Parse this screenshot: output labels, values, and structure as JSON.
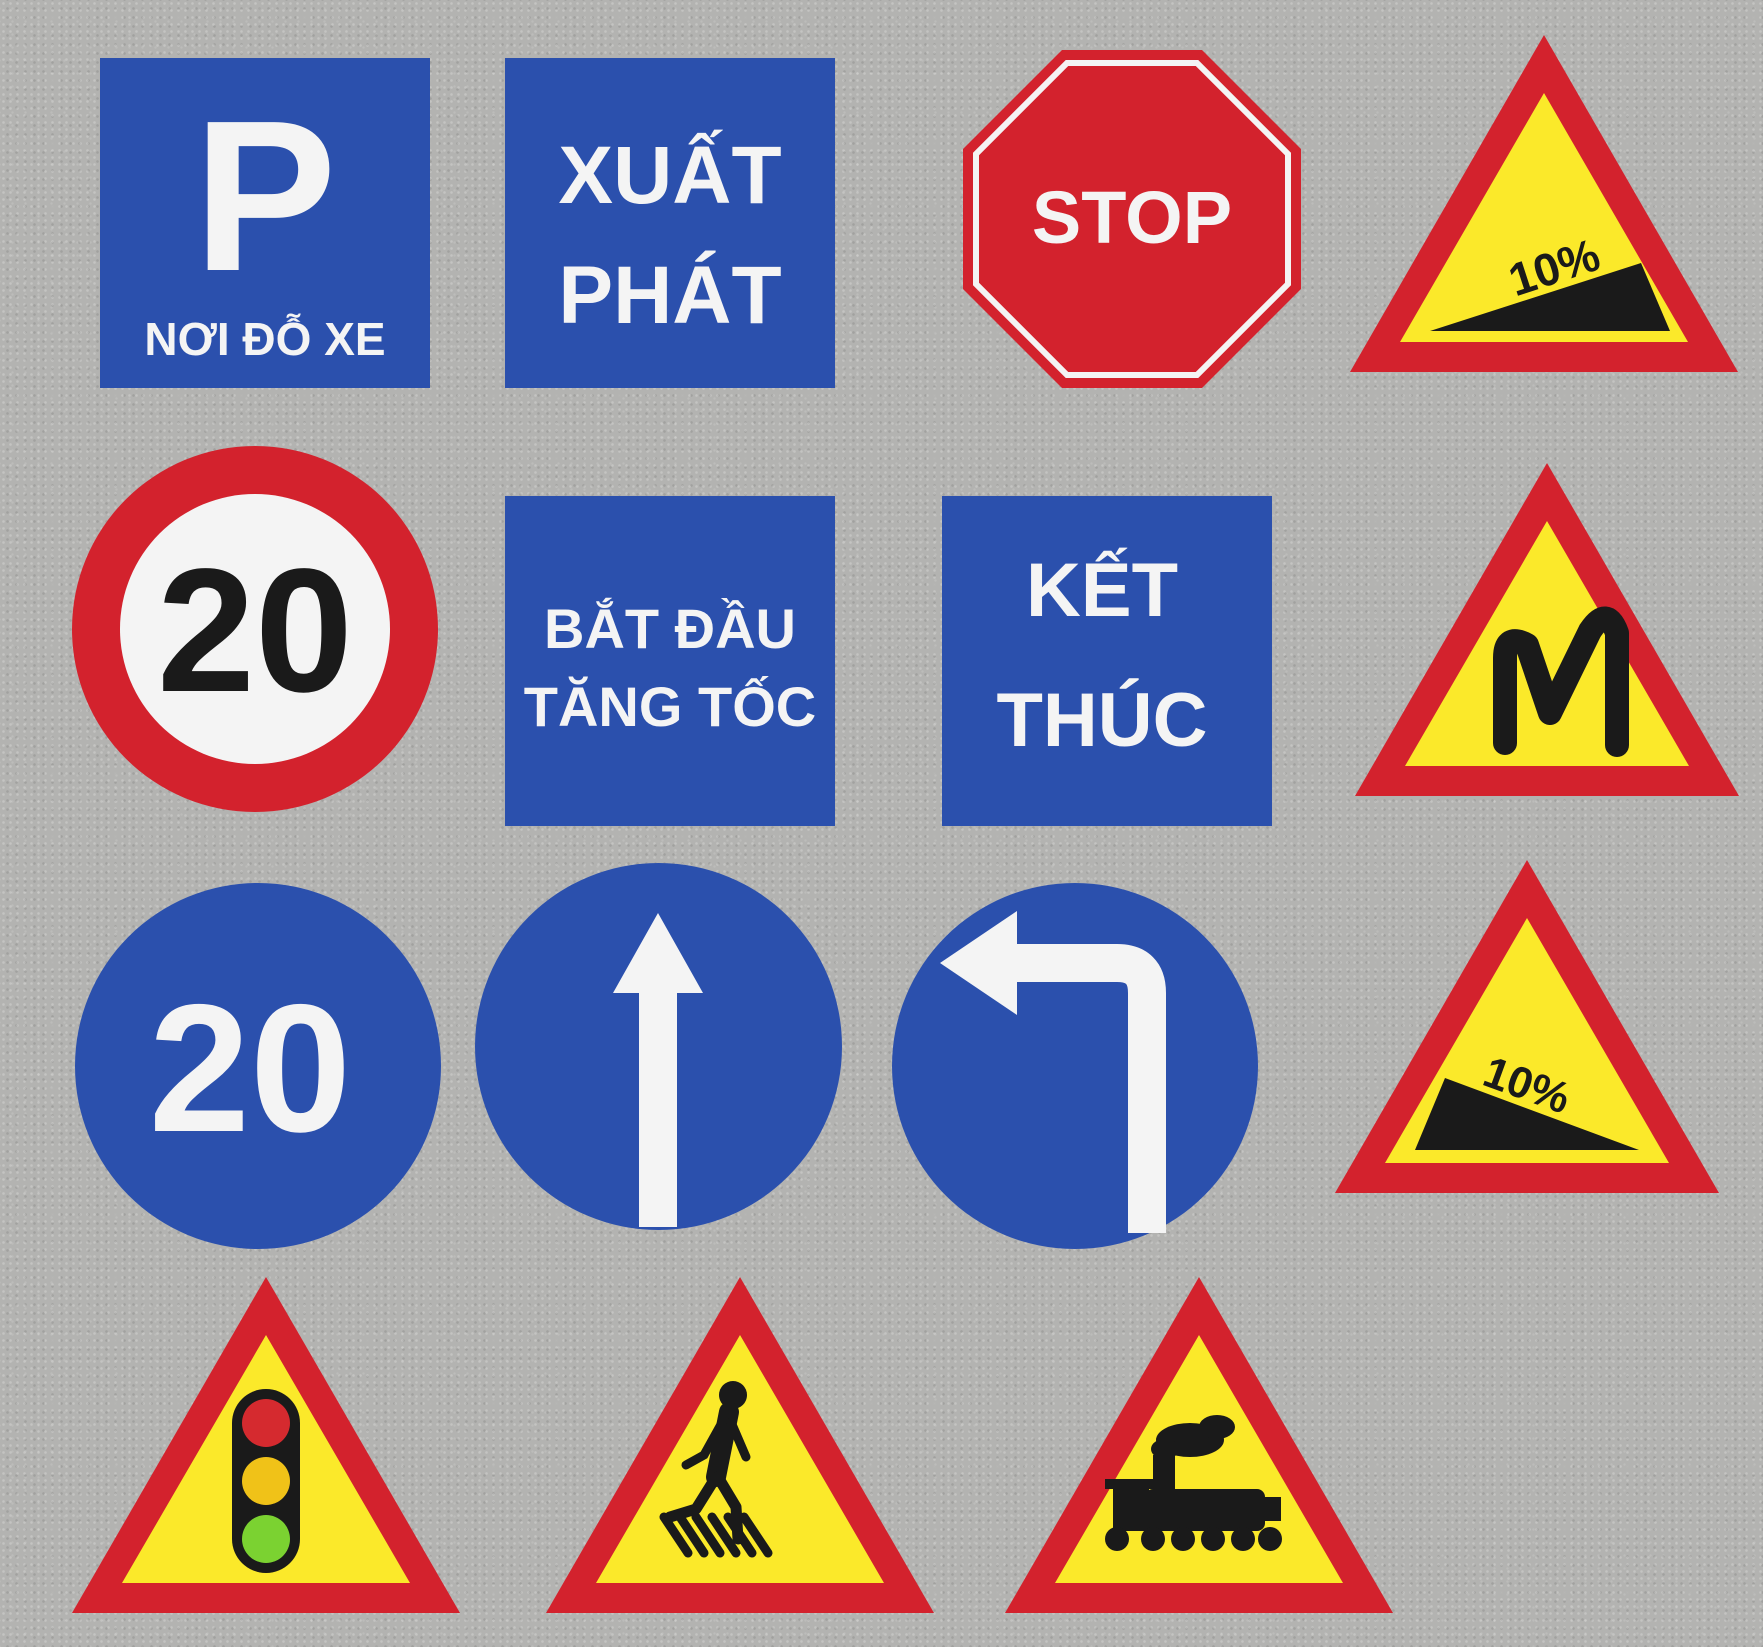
{
  "colors": {
    "background": "#b3b3b1",
    "blue": "#2b50ad",
    "red": "#d3222d",
    "yellow": "#fbe92a",
    "white": "#f4f4f4",
    "black": "#1a1a1a",
    "light_green": "#7bd231",
    "light_amber": "#f0c218",
    "light_red": "#d52a2f",
    "light_off": "#e8e8e8"
  },
  "signs": {
    "parking": {
      "icon": "parking-letter",
      "letter": "P",
      "caption": "NƠI ĐỖ XE"
    },
    "start": {
      "line1": "XUẤT",
      "line2": "PHÁT"
    },
    "stop": {
      "text": "STOP"
    },
    "steep_climb": {
      "icon": "steep-climb-icon",
      "grade": "10%"
    },
    "speed_limit": {
      "value": "20"
    },
    "begin_accel": {
      "line1": "BẮT ĐẦU",
      "line2": "TĂNG TỐC"
    },
    "finish": {
      "line1": "KẾT",
      "line2": "THÚC"
    },
    "double_curve": {
      "icon": "double-curve-icon"
    },
    "min_speed": {
      "value": "20"
    },
    "straight_only": {
      "icon": "arrow-up-icon"
    },
    "turn_left": {
      "icon": "arrow-turn-left-icon"
    },
    "steep_descent": {
      "icon": "steep-descent-icon",
      "grade": "10%"
    },
    "traffic_lights": {
      "icon": "traffic-light-icon"
    },
    "pedestrian_crossing": {
      "icon": "pedestrian-icon"
    },
    "railway_crossing": {
      "icon": "locomotive-icon"
    }
  }
}
